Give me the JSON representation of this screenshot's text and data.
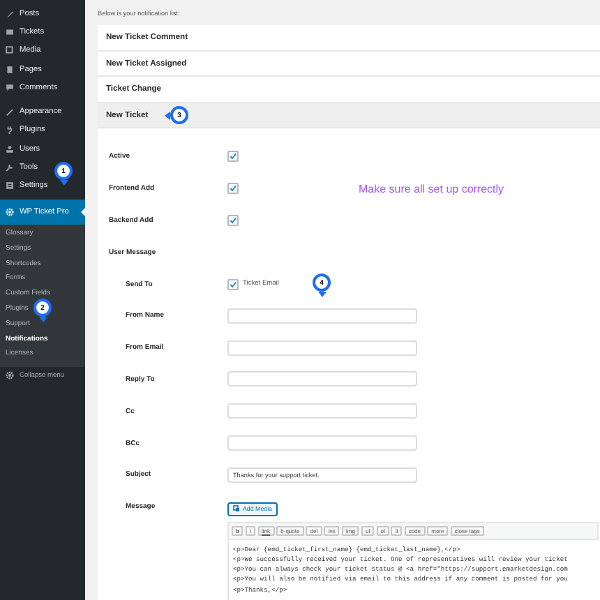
{
  "sidebar": {
    "groups": [
      {
        "items": [
          {
            "label": "Posts",
            "selected": false
          },
          {
            "label": "Tickets",
            "selected": false
          },
          {
            "label": "Media",
            "selected": false
          },
          {
            "label": "Pages",
            "selected": false
          },
          {
            "label": "Comments",
            "selected": false
          }
        ]
      },
      {
        "items": [
          {
            "label": "Appearance",
            "selected": false
          },
          {
            "label": "Plugins",
            "selected": false
          },
          {
            "label": "Users",
            "selected": false
          },
          {
            "label": "Tools",
            "selected": false
          },
          {
            "label": "Settings",
            "selected": false
          },
          {
            "label": "WP Ticket Pro",
            "selected": true
          }
        ]
      }
    ],
    "submenu": [
      {
        "label": "Glossary",
        "selected": false
      },
      {
        "label": "Settings",
        "selected": false
      },
      {
        "label": "Shortcodes",
        "selected": false
      },
      {
        "label": "Forms",
        "selected": false
      },
      {
        "label": "Custom Fields",
        "selected": false
      },
      {
        "label": "Plugins",
        "selected": false
      },
      {
        "label": "Support",
        "selected": false
      },
      {
        "label": "Notifications",
        "selected": true
      },
      {
        "label": "Licenses",
        "selected": false
      }
    ],
    "collapse": "Collapse menu"
  },
  "intro": "Below is your notification list:",
  "notifications": [
    {
      "title": "New Ticket Comment",
      "expanded": false
    },
    {
      "title": "New Ticket Assigned",
      "expanded": false
    },
    {
      "title": "Ticket Change",
      "expanded": false
    },
    {
      "title": "New Ticket",
      "expanded": true
    }
  ],
  "form": {
    "rows": [
      {
        "kind": "checkbox",
        "label": "Active",
        "checked": true
      },
      {
        "kind": "checkbox",
        "label": "Frontend Add",
        "checked": true
      },
      {
        "kind": "checkbox",
        "label": "Backend Add",
        "checked": true
      },
      {
        "kind": "heading",
        "label": "User Message"
      },
      {
        "kind": "option",
        "label": "Send To",
        "checked": true,
        "option": "Ticket Email"
      },
      {
        "kind": "text",
        "label": "From Name"
      },
      {
        "kind": "text",
        "label": "From Email"
      },
      {
        "kind": "text",
        "label": "Reply To"
      },
      {
        "kind": "text",
        "label": "Cc"
      },
      {
        "kind": "text",
        "label": "BCc"
      },
      {
        "kind": "text",
        "label": "Subject",
        "value": "Thanks for your support ticket."
      },
      {
        "kind": "editor",
        "label": "Message"
      }
    ]
  },
  "editor": {
    "add_media": "Add Media",
    "toolbar": [
      "b",
      "i",
      "link",
      "b-quote",
      "del",
      "ins",
      "img",
      "ul",
      "ol",
      "li",
      "code",
      "more",
      "close tags"
    ],
    "lines": [
      "<p>Dear {emd_ticket_first_name} {emd_ticket_last_name},</p>",
      "<p>We successfully received your ticket. One of representatives will review your ticket",
      "<p>You can always check your ticket status @ <a href=\"https://support.emarketdesign.com",
      "<p>You will also be notified via email to this address if any comment is posted for you",
      "<p>Thanks,</p>"
    ]
  },
  "annotations": {
    "markers": [
      "1",
      "2",
      "3",
      "4"
    ],
    "note": "Make sure all set up correctly"
  }
}
